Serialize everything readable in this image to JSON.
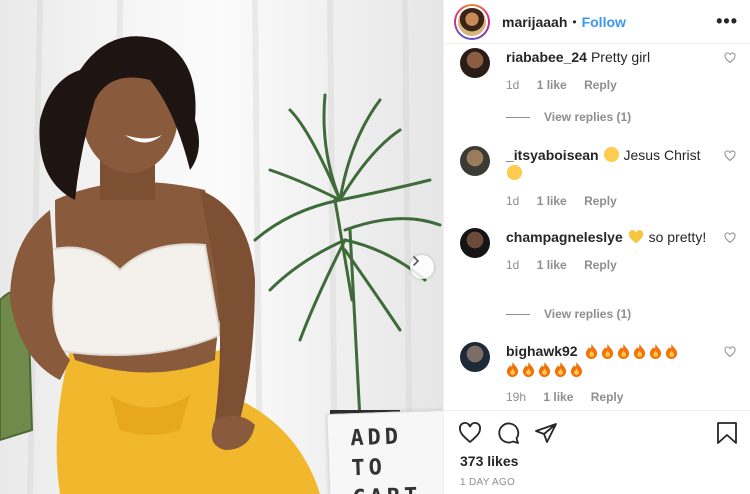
{
  "post": {
    "username": "marijaaah",
    "separator": "•",
    "follow_label": "Follow",
    "more_label": "•••",
    "lightbox_lines": [
      "ADD",
      "TO",
      "CART"
    ]
  },
  "comments": [
    {
      "user": "riababee_24",
      "text": "Pretty girl",
      "emoji": "",
      "text2": "",
      "time": "1d",
      "likes": "1 like",
      "reply": "Reply",
      "view_replies": "View replies (1)",
      "avatar_color": "#3b2a22"
    },
    {
      "user": "_itsyaboisean",
      "text": "Jesus Christ",
      "emoji": "heart-eyes + sweat-smile",
      "text2": "",
      "time": "1d",
      "likes": "1 like",
      "reply": "Reply",
      "view_replies": "",
      "avatar_color": "#5a4636"
    },
    {
      "user": "champagneleslye",
      "text": "so pretty!",
      "emoji": "yellow-heart",
      "text2": "",
      "time": "1d",
      "likes": "1 like",
      "reply": "Reply",
      "view_replies": "View replies (1)",
      "avatar_color": "#2b2b2b"
    },
    {
      "user": "bighawk92",
      "text": "",
      "emoji": "fire x11",
      "text2": "",
      "time": "19h",
      "likes": "1 like",
      "reply": "Reply",
      "view_replies": "",
      "avatar_color": "#24303d"
    }
  ],
  "footer": {
    "likes": "373 likes",
    "date": "1 DAY AGO"
  },
  "colors": {
    "accent": "#3897f0",
    "muted": "#8e8e8e",
    "text": "#262626"
  },
  "icons": [
    "heart-icon",
    "comment-icon",
    "share-icon",
    "bookmark-icon",
    "chevron-right-icon",
    "more-icon"
  ]
}
